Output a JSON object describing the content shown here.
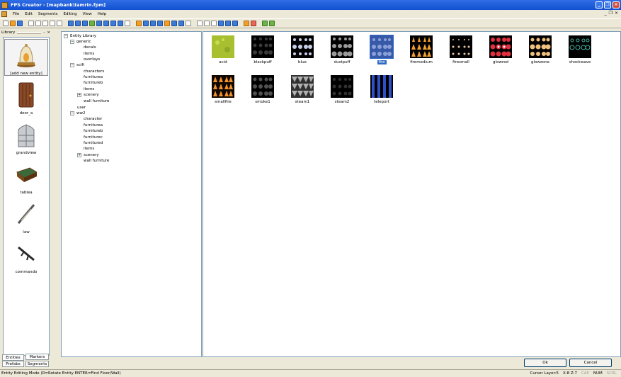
{
  "window": {
    "title": "FPS Creator - [mapbank\\tamrin.fpm]"
  },
  "menu": [
    "File",
    "Edit",
    "Segments",
    "Editing",
    "View",
    "Help"
  ],
  "library": {
    "title": "Library",
    "items": [
      {
        "label": "[add new entity]",
        "icon": "bell-jar-icon"
      },
      {
        "label": "door_a",
        "icon": "wooden-door-icon"
      },
      {
        "label": "grandview",
        "icon": "arched-window-icon"
      },
      {
        "label": "tablea",
        "icon": "table-icon"
      },
      {
        "label": "law",
        "icon": "rifle-icon"
      },
      {
        "label": "commando",
        "icon": "gun-icon"
      }
    ],
    "tabs": {
      "entities": "Entities",
      "markers": "Markers",
      "prefabs": "Prefabs",
      "segments": "Segments"
    }
  },
  "tree": {
    "root": "Entity Library",
    "rows": [
      "generic",
      "decals",
      "items",
      "overlays",
      "scifi",
      "characters",
      "furniturea",
      "furnitureb",
      "items",
      "scenery",
      "wall furniture",
      "user",
      "ww2",
      "character",
      "furniturea",
      "furnitureb",
      "furniturec",
      "furnitured",
      "items",
      "scenery",
      "wall furniture"
    ]
  },
  "tiles": [
    {
      "label": "acid"
    },
    {
      "label": "blackpuff"
    },
    {
      "label": "blue"
    },
    {
      "label": "dustpuff"
    },
    {
      "label": "fire"
    },
    {
      "label": "firemedium"
    },
    {
      "label": "firesmall"
    },
    {
      "label": "glowred"
    },
    {
      "label": "glowzone"
    },
    {
      "label": "shockwave"
    },
    {
      "label": "smallfire"
    },
    {
      "label": "smoke1"
    },
    {
      "label": "steam1"
    },
    {
      "label": "steam2"
    },
    {
      "label": "teleport"
    }
  ],
  "selected_tile": "fire",
  "buttons": {
    "ok": "Ok",
    "cancel": "Cancel"
  },
  "status": {
    "left": "Entity Editing Mode (R=Rotate Entity  ENTER=Find Floor/Wall)",
    "cursor": "Cursor Layer:5",
    "xy": "X:8  Z:7",
    "caps": "CAP",
    "num": "NUM",
    "scrl": "SCRL"
  }
}
